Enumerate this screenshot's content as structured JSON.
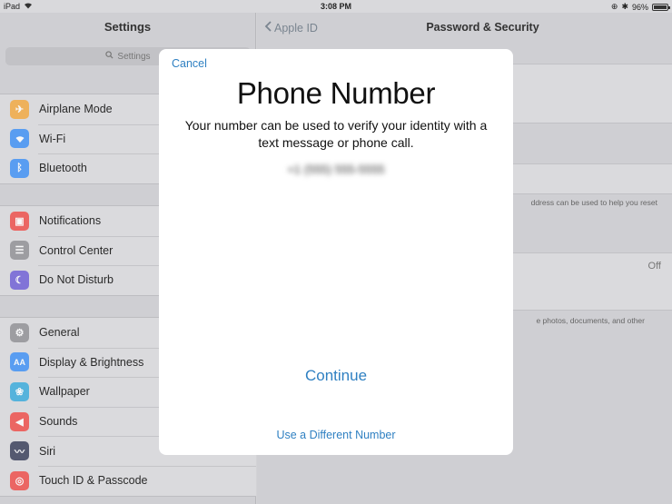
{
  "status_bar": {
    "device": "iPad",
    "time": "3:08 PM",
    "battery": "96%"
  },
  "settings": {
    "title": "Settings",
    "search_placeholder": "Settings",
    "groups": [
      [
        {
          "label": "Airplane Mode",
          "icon": "airplane-icon",
          "color": "#f4a73b"
        },
        {
          "label": "Wi-Fi",
          "icon": "wifi-icon",
          "color": "#3a8ef6"
        },
        {
          "label": "Bluetooth",
          "icon": "bluetooth-icon",
          "color": "#3a8ef6"
        }
      ],
      [
        {
          "label": "Notifications",
          "icon": "notifications-icon",
          "color": "#f04a45"
        },
        {
          "label": "Control Center",
          "icon": "control-center-icon",
          "color": "#8e8e93"
        },
        {
          "label": "Do Not Disturb",
          "icon": "moon-icon",
          "color": "#6b5bd6"
        }
      ],
      [
        {
          "label": "General",
          "icon": "gear-icon",
          "color": "#8e8e93"
        },
        {
          "label": "Display & Brightness",
          "icon": "display-icon",
          "color": "#3a8ef6"
        },
        {
          "label": "Wallpaper",
          "icon": "wallpaper-icon",
          "color": "#34aadc"
        },
        {
          "label": "Sounds",
          "icon": "sounds-icon",
          "color": "#f04a45"
        },
        {
          "label": "Siri",
          "icon": "siri-icon",
          "color": "#333a56"
        },
        {
          "label": "Touch ID & Passcode",
          "icon": "fingerprint-icon",
          "color": "#f04a45"
        }
      ]
    ]
  },
  "detail": {
    "back_label": "Apple ID",
    "title": "Password & Security",
    "footnote_1": "ddress can be used to help you reset",
    "off_value": "Off",
    "footnote_2": "e photos, documents, and other"
  },
  "modal": {
    "cancel": "Cancel",
    "title": "Phone Number",
    "description": "Your number can be used to verify your identity with a text message or phone call.",
    "number": "+1 (555) 555-5555",
    "continue": "Continue",
    "different_number": "Use a Different Number"
  }
}
